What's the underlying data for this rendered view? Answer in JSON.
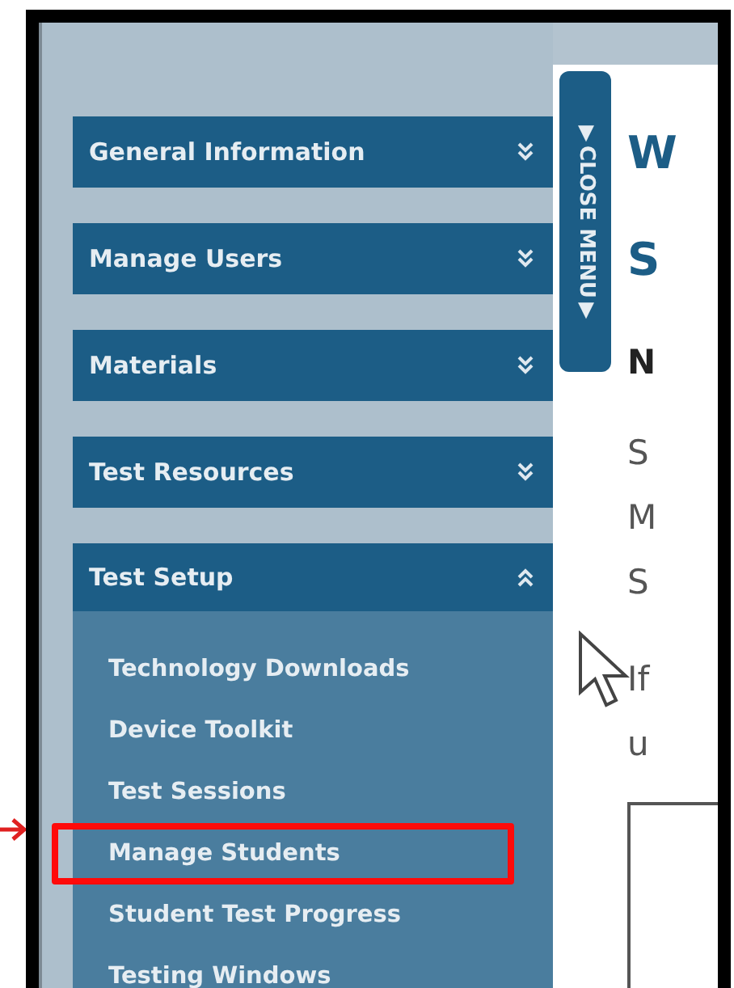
{
  "sidebar": {
    "sections": [
      {
        "label": "General Information",
        "expanded": false
      },
      {
        "label": "Manage Users",
        "expanded": false
      },
      {
        "label": "Materials",
        "expanded": false
      },
      {
        "label": "Test Resources",
        "expanded": false
      },
      {
        "label": "Test Setup",
        "expanded": true,
        "items": [
          {
            "label": "Technology Downloads",
            "highlighted": false
          },
          {
            "label": "Device Toolkit",
            "highlighted": false
          },
          {
            "label": "Test Sessions",
            "highlighted": false
          },
          {
            "label": "Manage Students",
            "highlighted": true
          },
          {
            "label": "Student Test Progress",
            "highlighted": false
          },
          {
            "label": "Testing Windows",
            "highlighted": false
          }
        ]
      }
    ]
  },
  "close_menu": "▼CLOSE MENU▼",
  "content": {
    "lines": [
      {
        "kind": "title",
        "text": "W"
      },
      {
        "kind": "title",
        "text": "S"
      },
      {
        "kind": "heading",
        "text": "N"
      },
      {
        "kind": "body",
        "text": "S"
      },
      {
        "kind": "body",
        "text": "M"
      },
      {
        "kind": "body",
        "text": "S"
      },
      {
        "kind": "para",
        "text": "If"
      },
      {
        "kind": "body",
        "text": "u"
      }
    ]
  }
}
